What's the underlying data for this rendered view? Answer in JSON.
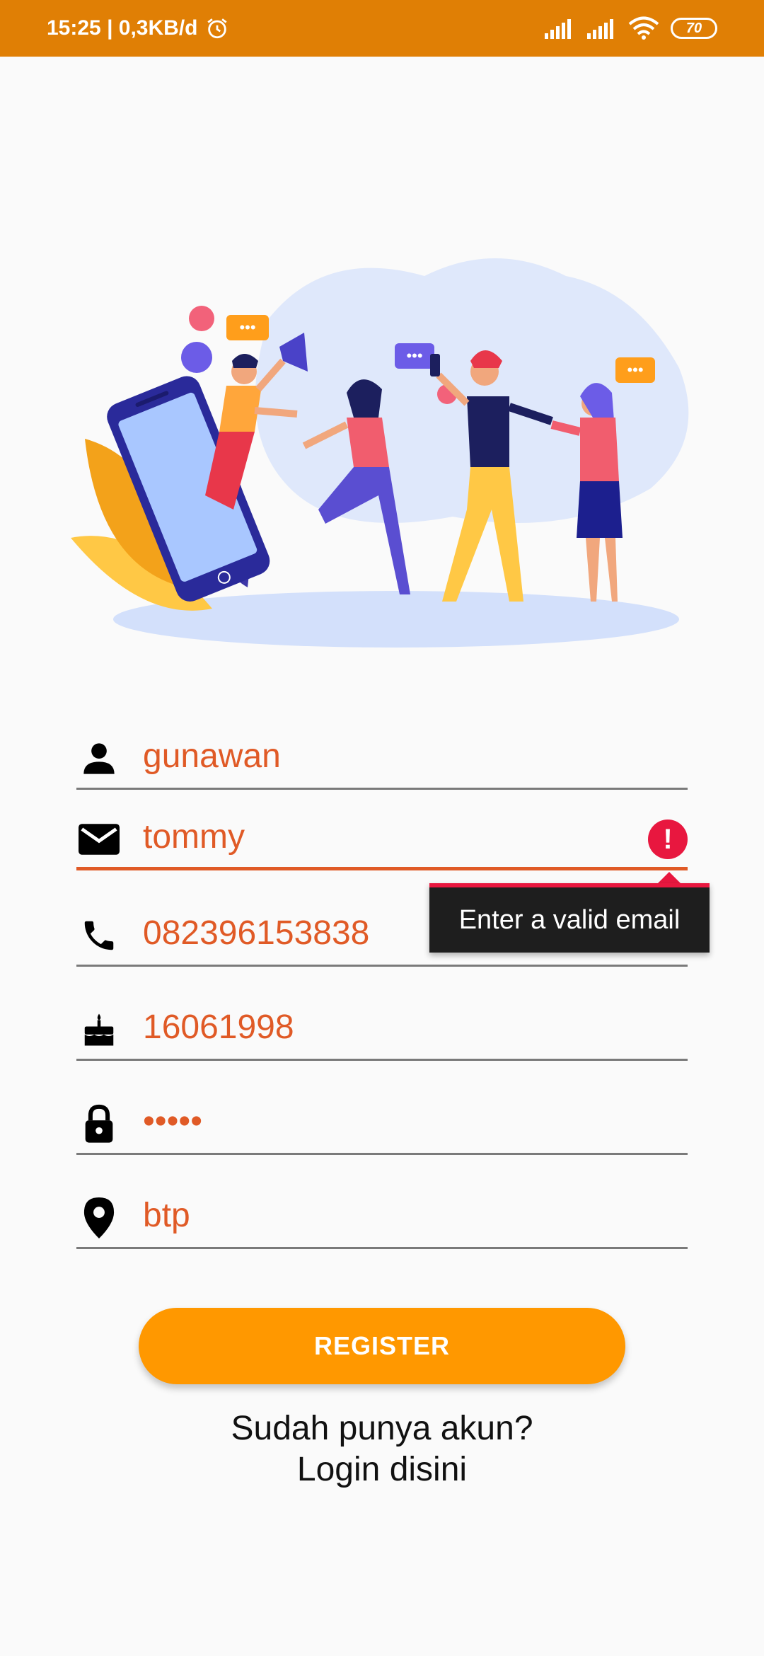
{
  "status_bar": {
    "time_speed": "15:25 | 0,3KB/d",
    "battery": "70"
  },
  "form": {
    "name_value": "gunawan",
    "email_value": "tommy",
    "phone_value": "082396153838",
    "birthdate_value": "16061998",
    "password_value": "•••••",
    "address_value": "btp"
  },
  "error_tooltip": "Enter a valid email",
  "register_label": "REGISTER",
  "login": {
    "line1": "Sudah punya akun?",
    "line2": "Login disini"
  },
  "colors": {
    "status_bar": "#e07f05",
    "accent": "#ff9800",
    "input_text": "#e05a26",
    "error": "#e8173f"
  }
}
